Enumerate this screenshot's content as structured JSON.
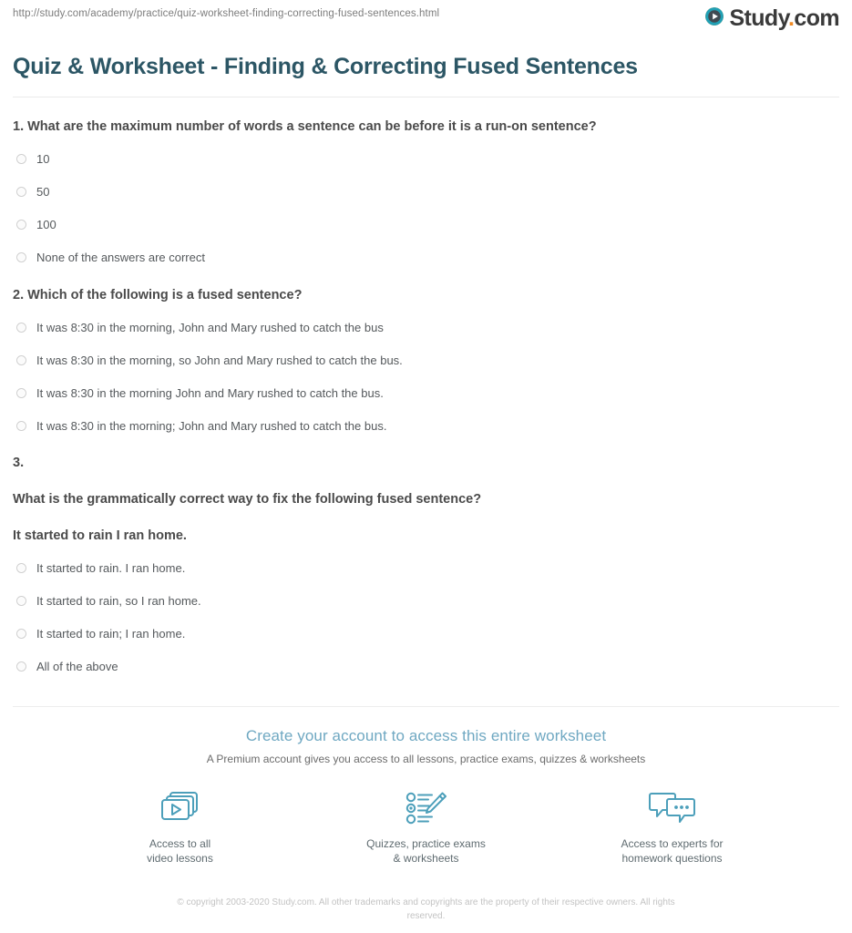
{
  "header": {
    "url": "http://study.com/academy/practice/quiz-worksheet-finding-correcting-fused-sentences.html",
    "logo_text_primary": "Study",
    "logo_dot": ".",
    "logo_text_secondary": "com",
    "logo_icon": "play-circle-icon"
  },
  "title": "Quiz & Worksheet - Finding & Correcting Fused Sentences",
  "colors": {
    "title": "#2c5665",
    "cta_heading": "#6fa8c2",
    "icon_accent": "#4c9fba",
    "logo_dot": "#f08a24",
    "logo_mark_teal": "#21a0b5",
    "logo_mark_orange": "#f08a24",
    "question_text": "#4a4a4a",
    "answer_text": "#55595c",
    "copyright": "#c3c3c3"
  },
  "questions": [
    {
      "number": "1.",
      "prompt": "1. What are the maximum number of words a sentence can be before it is a run-on sentence?",
      "subline": "",
      "answers": [
        "10",
        "50",
        "100",
        "None of the answers are correct"
      ]
    },
    {
      "number": "2.",
      "prompt": "2. Which of the following is a fused sentence?",
      "subline": "",
      "answers": [
        "It was 8:30 in the morning, John and Mary rushed to catch the bus",
        "It was 8:30 in the morning, so John and Mary rushed to catch the bus.",
        "It was 8:30 in the morning John and Mary rushed to catch the bus.",
        "It was 8:30 in the morning; John and Mary rushed to catch the bus."
      ]
    },
    {
      "number": "3.",
      "prompt": "3.",
      "prompt_line2": "What is the grammatically correct way to fix the following fused sentence?",
      "subline": "It started to rain I ran home.",
      "answers": [
        "It started to rain. I ran home.",
        "It started to rain, so I ran home.",
        "It started to rain; I ran home.",
        "All of the above"
      ]
    }
  ],
  "cta": {
    "heading": "Create your account to access this entire worksheet",
    "subheading": "A Premium account gives you access to all lessons, practice exams, quizzes & worksheets",
    "features": [
      {
        "icon": "video-stack-icon",
        "label": "Access to all\nvideo lessons"
      },
      {
        "icon": "checklist-pencil-icon",
        "label": "Quizzes, practice exams\n& worksheets"
      },
      {
        "icon": "chat-bubbles-icon",
        "label": "Access to experts for\nhomework questions"
      }
    ]
  },
  "copyright": "© copyright 2003-2020 Study.com. All other trademarks and copyrights are the property of their respective owners. All rights reserved."
}
